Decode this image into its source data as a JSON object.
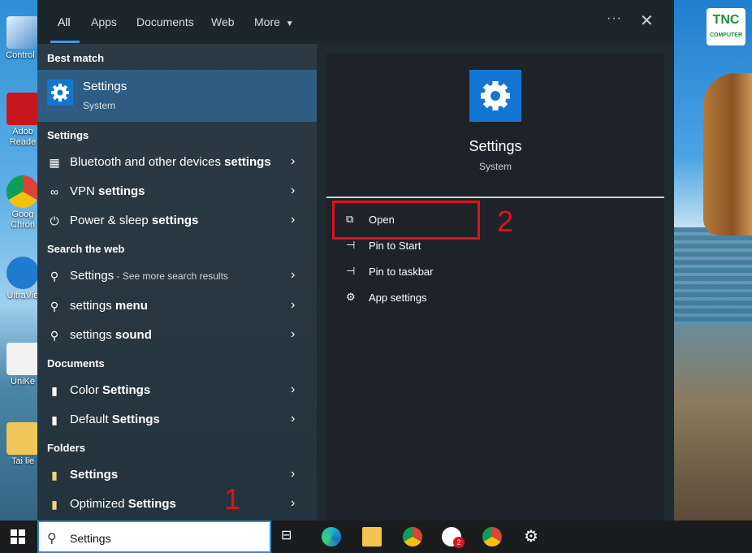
{
  "desktop": {
    "icons": [
      {
        "label": "Control I"
      },
      {
        "label": "Adob Reade"
      },
      {
        "label": "Goog Chron"
      },
      {
        "label": "UltraVie"
      },
      {
        "label": "UniKe"
      },
      {
        "label": "Tai lie"
      }
    ],
    "brand_logo": {
      "main": "TNC",
      "sub": "COMPUTER"
    }
  },
  "start_menu": {
    "tabs": [
      {
        "label": "All",
        "active": true
      },
      {
        "label": "Apps"
      },
      {
        "label": "Documents"
      },
      {
        "label": "Web"
      },
      {
        "label": "More"
      }
    ],
    "more_options_label": "···",
    "close_label": "✕",
    "best_match": {
      "heading": "Best match",
      "title": "Settings",
      "subtitle": "System"
    },
    "sections": {
      "settings": {
        "heading": "Settings",
        "items": [
          {
            "prefix": "Bluetooth and other devices ",
            "bold": "settings",
            "icon": "bluetooth-devices-icon"
          },
          {
            "prefix": "VPN ",
            "bold": "settings",
            "icon": "vpn-icon"
          },
          {
            "prefix": "Power & sleep ",
            "bold": "settings",
            "icon": "power-icon"
          }
        ]
      },
      "web": {
        "heading": "Search the web",
        "items": [
          {
            "prefix": "Settings",
            "bold": "",
            "extra": " - See more search results",
            "icon": "search-icon"
          },
          {
            "prefix": "settings ",
            "bold": "menu",
            "icon": "search-icon"
          },
          {
            "prefix": "settings ",
            "bold": "sound",
            "icon": "search-icon"
          }
        ]
      },
      "documents": {
        "heading": "Documents",
        "items": [
          {
            "prefix": "Color ",
            "bold": "Settings",
            "icon": "document-icon"
          },
          {
            "prefix": "Default ",
            "bold": "Settings",
            "icon": "document-icon"
          }
        ]
      },
      "folders": {
        "heading": "Folders",
        "items": [
          {
            "prefix": "",
            "bold": "Settings",
            "icon": "folder-icon"
          },
          {
            "prefix": "Optimized ",
            "bold": "Settings",
            "icon": "folder-icon"
          }
        ]
      }
    },
    "preview": {
      "title": "Settings",
      "subtitle": "System",
      "actions": [
        {
          "label": "Open",
          "icon": "open-icon"
        },
        {
          "label": "Pin to Start",
          "icon": "pin-icon"
        },
        {
          "label": "Pin to taskbar",
          "icon": "pin-icon"
        },
        {
          "label": "App settings",
          "icon": "gear-icon"
        }
      ]
    }
  },
  "annotations": {
    "step1": "1",
    "step2": "2"
  },
  "taskbar": {
    "search_value": "Settings",
    "zalo_badge": "2"
  },
  "colors": {
    "accent": "#1376d2",
    "annotation": "#e0121b",
    "selected": "#2e5c82"
  }
}
